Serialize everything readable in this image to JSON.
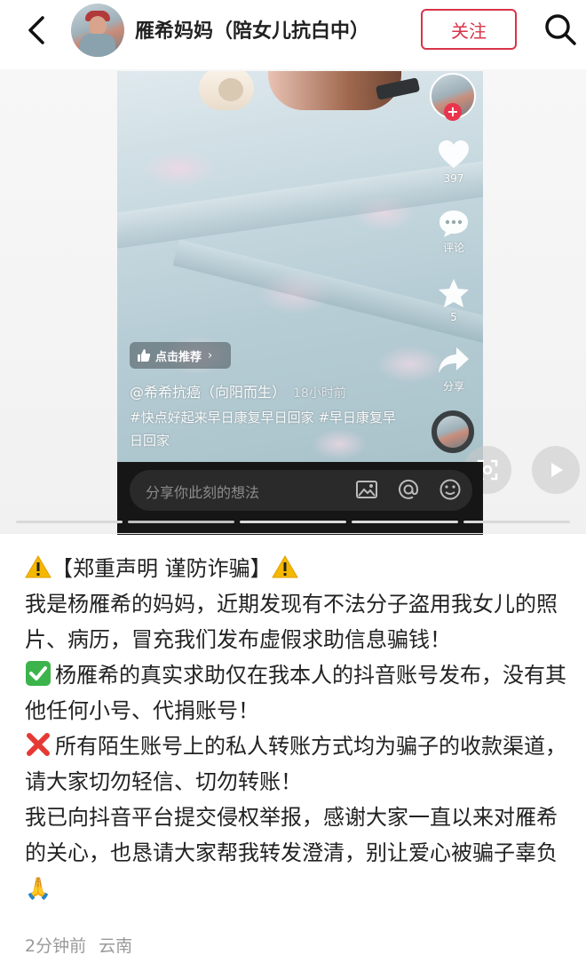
{
  "header": {
    "title": "雁希妈妈（陪女儿抗白中）",
    "follow_label": "关注"
  },
  "video": {
    "recommend_label": "点击推荐",
    "author_tag": "@希希抗癌（向阳而生）",
    "time_ago": "18小时前",
    "hashtags": "#快点好起来早日康复早日回家 #早日康复早日回家",
    "likes": "397",
    "comment_label": "评论",
    "favorites": "5",
    "share_label": "分享",
    "comment_placeholder": "分享你此刻的想法"
  },
  "post": {
    "line1": "【郑重声明 谨防诈骗】",
    "para1": "我是杨雁希的妈妈，近期发现有不法分子盗用我女儿的照片、病历，冒充我们发布虚假求助信息骗钱！",
    "para2": "杨雁希的真实求助仅在我本人的抖音账号发布，没有其他任何小号、代捐账号！",
    "para3": "所有陌生账号上的私人转账方式均为骗子的收款渠道，请大家切勿轻信、切勿转账！",
    "para4": "我已向抖音平台提交侵权举报，感谢大家一直以来对雁希的关心，也恳请大家帮我转发澄清，别让爱心被骗子辜负",
    "emoji_end": "🙏"
  },
  "meta": {
    "time": "2分钟前",
    "location": "云南"
  },
  "colors": {
    "accent": "#d9344a",
    "warn": "#f5b800",
    "check": "#3cb44b",
    "cross": "#e53935"
  }
}
